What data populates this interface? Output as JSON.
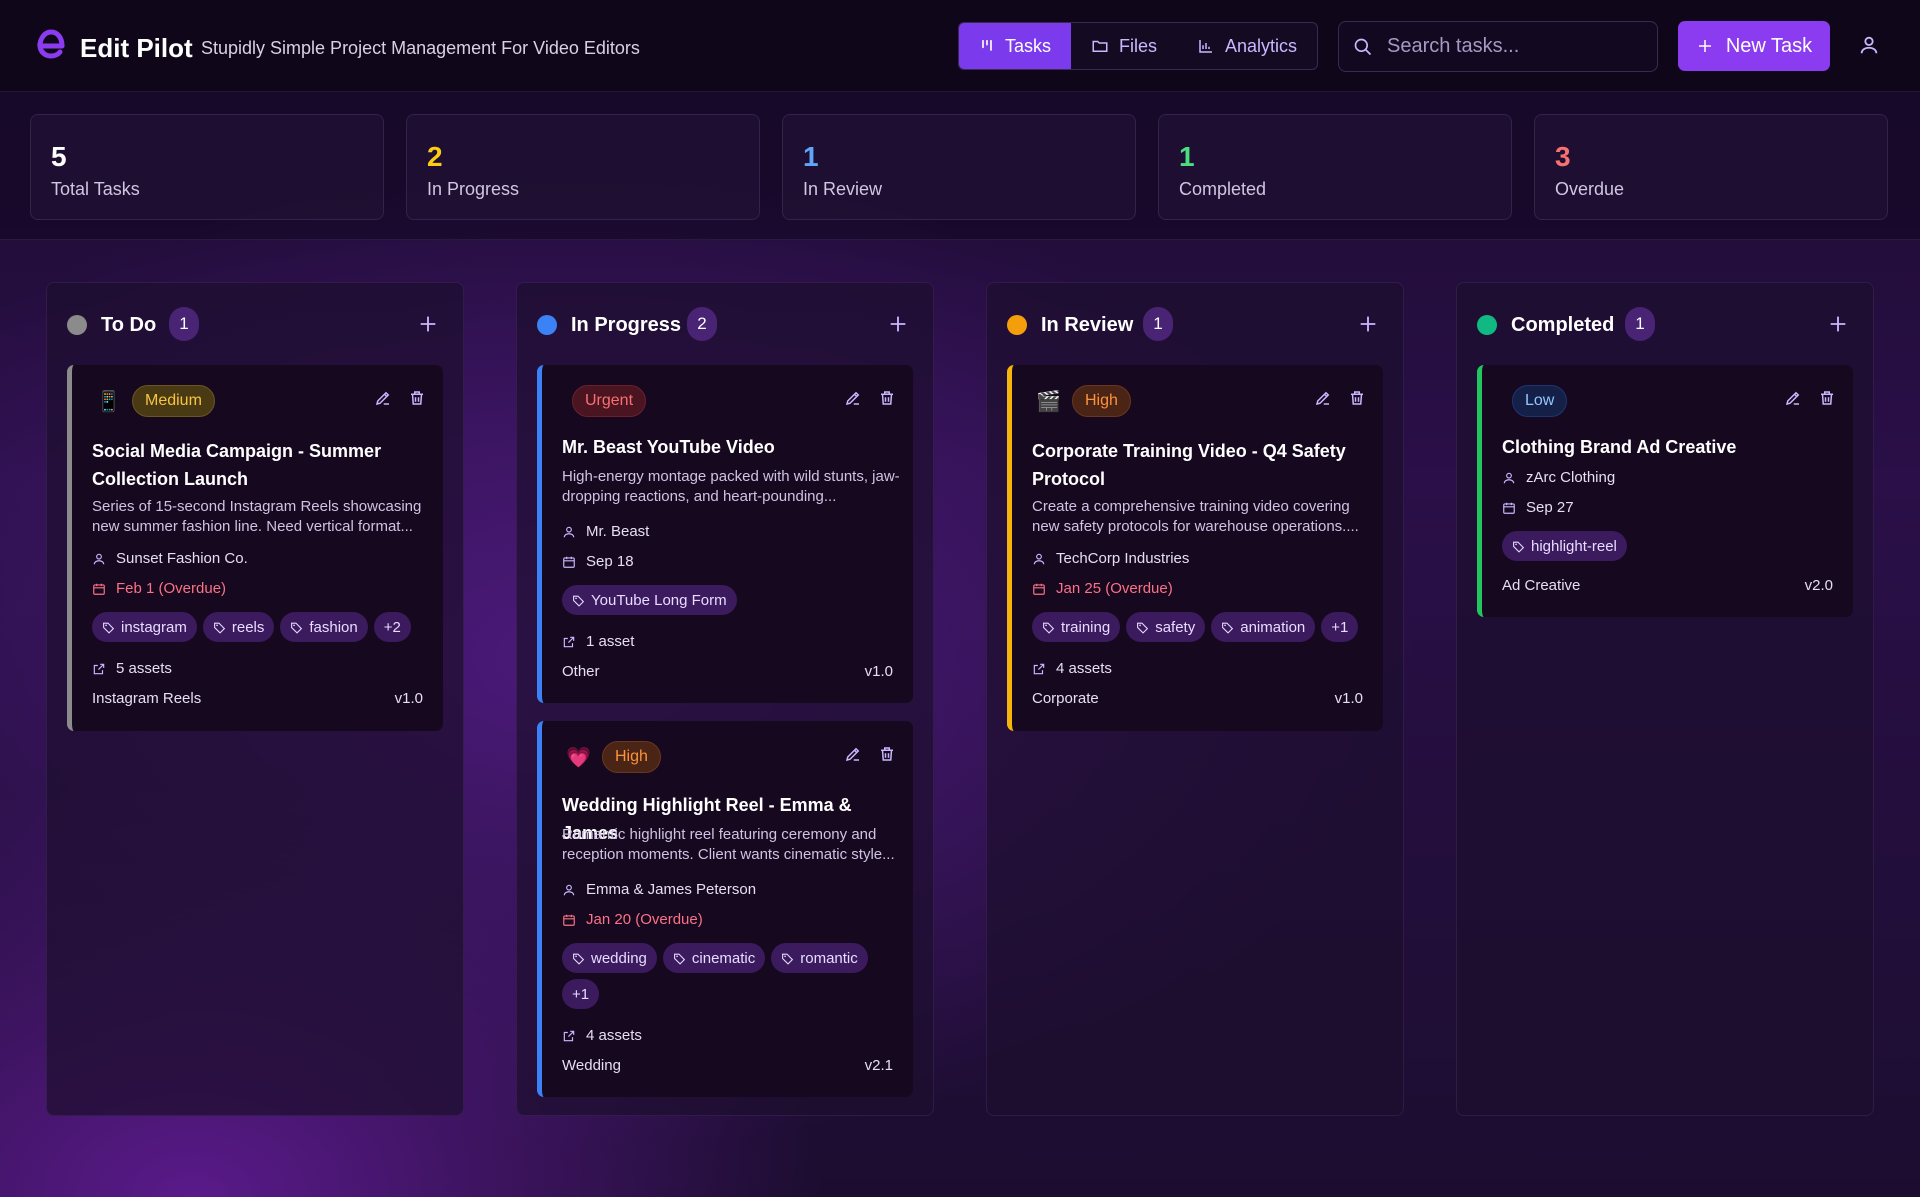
{
  "app": {
    "brand": "Edit Pilot",
    "tagline": "Stupidly Simple Project Management For Video Editors",
    "logo_letter": "e"
  },
  "nav": {
    "tasks": "Tasks",
    "files": "Files",
    "analytics": "Analytics"
  },
  "search": {
    "placeholder": "Search tasks..."
  },
  "new_task_label": "New Task",
  "stats": [
    {
      "value": "5",
      "label": "Total Tasks",
      "color": "#ffffff"
    },
    {
      "value": "2",
      "label": "In Progress",
      "color": "#facc15"
    },
    {
      "value": "1",
      "label": "In Review",
      "color": "#60a5fa"
    },
    {
      "value": "1",
      "label": "Completed",
      "color": "#4ade80"
    },
    {
      "value": "3",
      "label": "Overdue",
      "color": "#f87171"
    }
  ],
  "columns": [
    {
      "title": "To Do",
      "count": "1",
      "dot_color": "#8b8b8b"
    },
    {
      "title": "In Progress",
      "count": "2",
      "dot_color": "#3b82f6"
    },
    {
      "title": "In Review",
      "count": "1",
      "dot_color": "#f59e0b"
    },
    {
      "title": "Completed",
      "count": "1",
      "dot_color": "#10b981"
    }
  ],
  "cards": {
    "social": {
      "emoji": "📱",
      "priority": "Medium",
      "title": "Social Media Campaign - Summer Collection Launch",
      "desc": "Series of 15-second Instagram Reels showcasing new summer fashion line. Need vertical format...",
      "client": "Sunset Fashion Co.",
      "due": "Feb 1 (Overdue)",
      "tags": [
        "instagram",
        "reels",
        "fashion"
      ],
      "more": "+2",
      "assets": "5 assets",
      "type": "Instagram Reels",
      "version": "v1.0"
    },
    "mrbeast": {
      "priority": "Urgent",
      "title": "Mr. Beast YouTube Video",
      "desc": "High-energy montage packed with wild stunts, jaw-dropping reactions, and heart-pounding...",
      "client": "Mr. Beast",
      "due": "Sep 18",
      "tags": [
        "YouTube Long Form"
      ],
      "assets": "1 asset",
      "type": "Other",
      "version": "v1.0"
    },
    "wedding": {
      "emoji": "💗",
      "priority": "High",
      "title": "Wedding Highlight Reel - Emma & James",
      "desc": "Romantic highlight reel featuring ceremony and reception moments. Client wants cinematic style...",
      "client": "Emma & James Peterson",
      "due": "Jan 20 (Overdue)",
      "tags": [
        "wedding",
        "cinematic",
        "romantic"
      ],
      "more": "+1",
      "assets": "4 assets",
      "type": "Wedding",
      "version": "v2.1"
    },
    "corporate": {
      "emoji": "🎬",
      "priority": "High",
      "title": "Corporate Training Video - Q4 Safety Protocol",
      "desc": "Create a comprehensive training video covering new safety protocols for warehouse operations....",
      "client": "TechCorp Industries",
      "due": "Jan 25 (Overdue)",
      "tags": [
        "training",
        "safety",
        "animation"
      ],
      "more": "+1",
      "assets": "4 assets",
      "type": "Corporate",
      "version": "v1.0"
    },
    "clothing": {
      "priority": "Low",
      "title": "Clothing Brand Ad Creative",
      "client": "zArc Clothing",
      "due": "Sep 27",
      "tags": [
        "highlight-reel"
      ],
      "type": "Ad Creative",
      "version": "v2.0"
    }
  }
}
